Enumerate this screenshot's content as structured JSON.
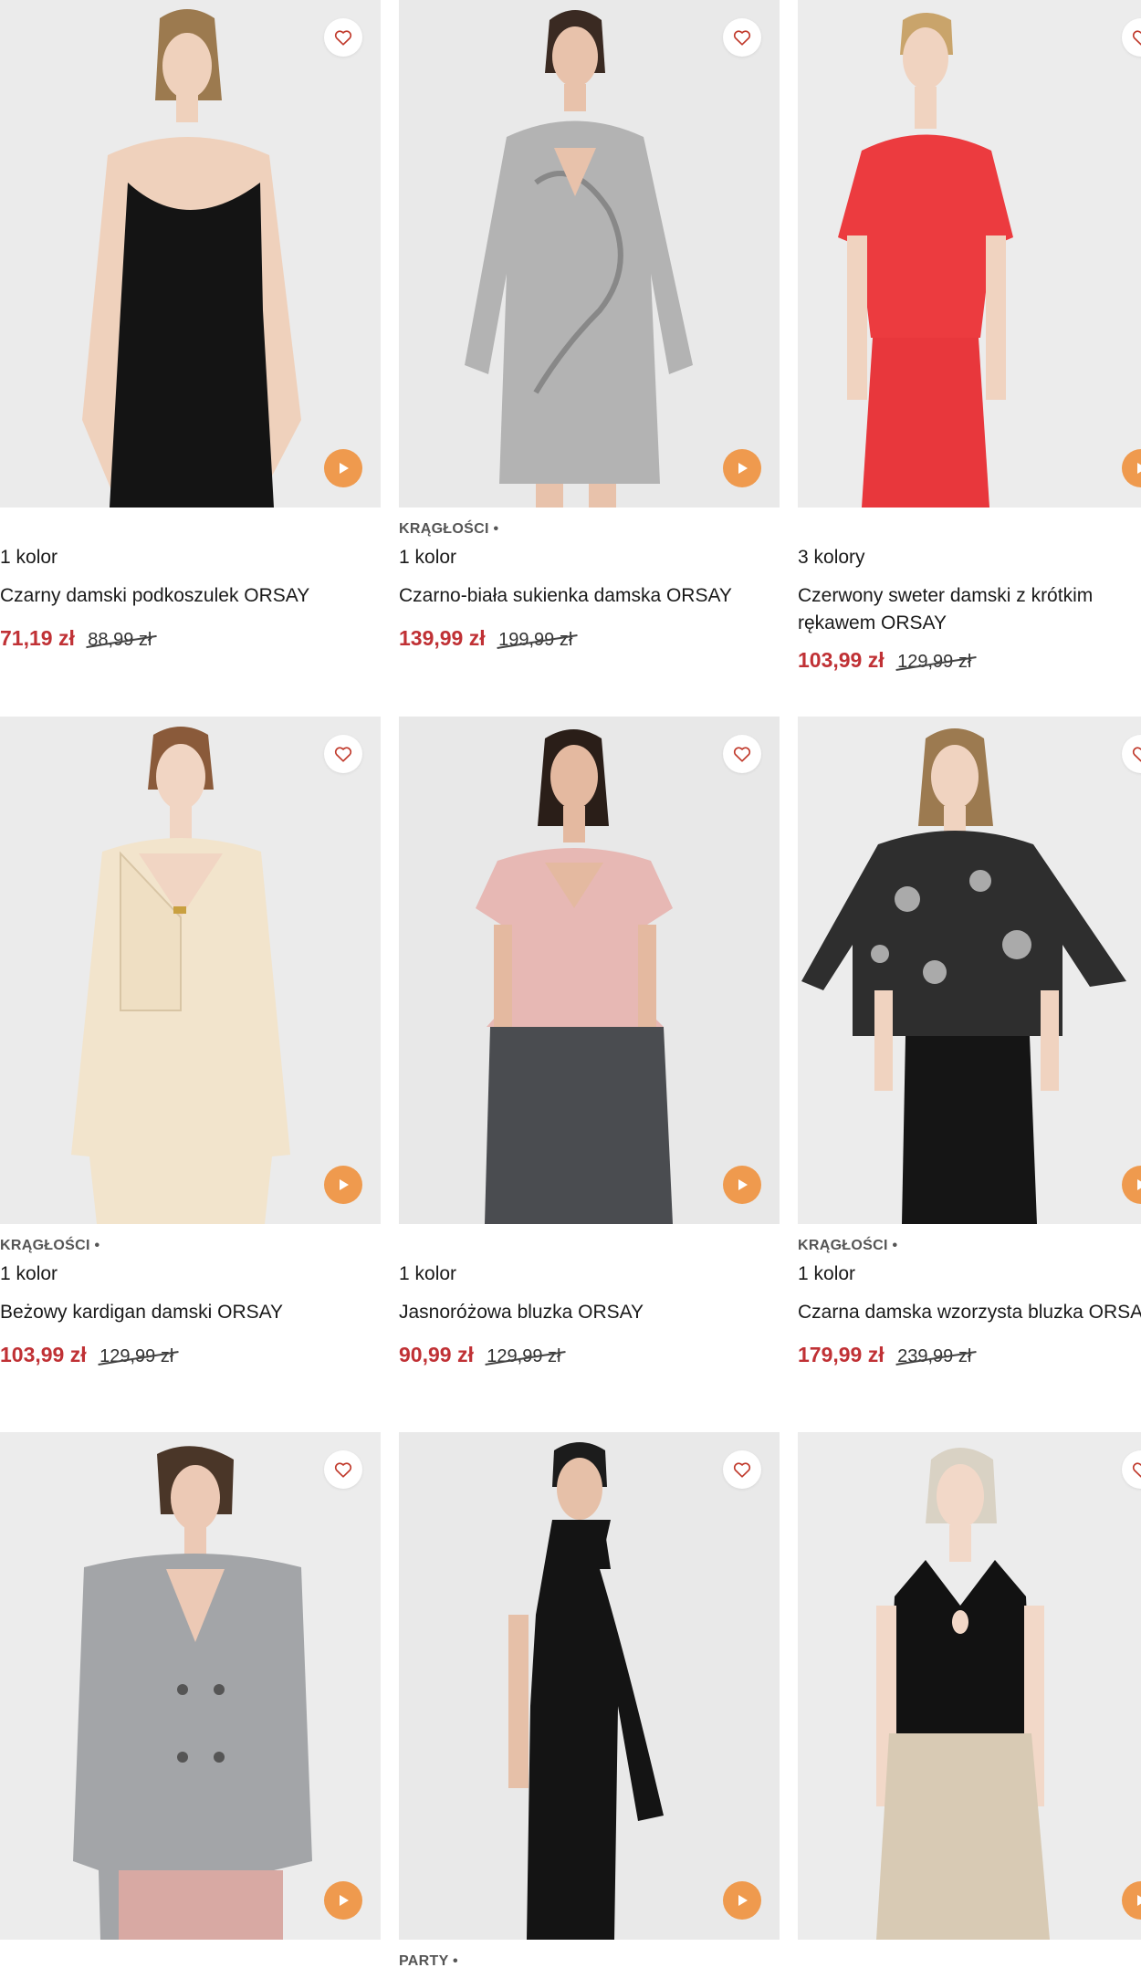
{
  "icons": {
    "favorite": "heart-outline-icon",
    "video": "play-icon"
  },
  "colors": {
    "price_sale": "#c03135",
    "play_button": "#ef9a4e",
    "heart": "#c0392b"
  },
  "products": [
    {
      "tag": "",
      "colors": "1 kolor",
      "name": "Czarny damski podkoszulek ORSAY",
      "price": "71,19 zł",
      "old_price": "88,99 zł"
    },
    {
      "tag": "KRĄGŁOŚCI •",
      "colors": "1 kolor",
      "name": "Czarno-biała sukienka damska ORSAY",
      "price": "139,99 zł",
      "old_price": "199,99 zł"
    },
    {
      "tag": "",
      "colors": "3 kolory",
      "name": "Czerwony sweter damski z krótkim rękawem ORSAY",
      "price": "103,99 zł",
      "old_price": "129,99 zł"
    },
    {
      "tag": "KRĄGŁOŚCI •",
      "colors": "1 kolor",
      "name": "Beżowy kardigan damski ORSAY",
      "price": "103,99 zł",
      "old_price": "129,99 zł"
    },
    {
      "tag": "",
      "colors": "1 kolor",
      "name": "Jasnoróżowa bluzka ORSAY",
      "price": "90,99 zł",
      "old_price": "129,99 zł"
    },
    {
      "tag": "KRĄGŁOŚCI •",
      "colors": "1 kolor",
      "name": "Czarna damska wzorzysta bluzka ORSAY",
      "price": "179,99 zł",
      "old_price": "239,99 zł"
    },
    {
      "tag": ""
    },
    {
      "tag": "PARTY •"
    },
    {
      "tag": ""
    }
  ]
}
